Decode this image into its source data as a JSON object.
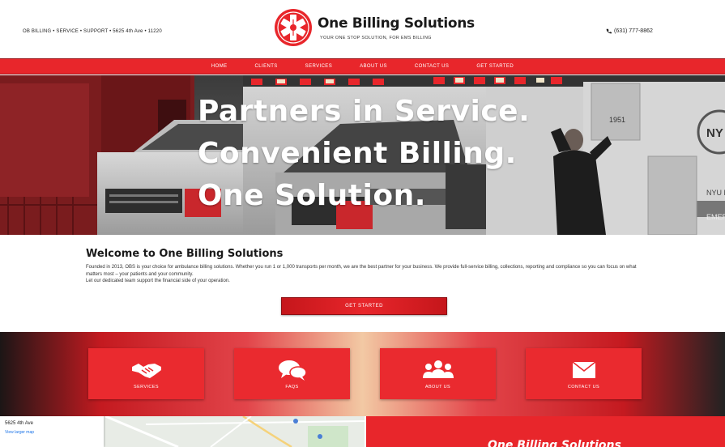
{
  "header": {
    "contact_left": "OB BILLING • SERVICE • SUPPORT • 5625 4th Ave • 11220",
    "brand_name": "One Billing Solutions",
    "tagline": "YOUR ONE STOP SOLUTION, FOR EMS BILLING",
    "phone": "(631) 777-8862",
    "phone_icon": "phone-icon"
  },
  "nav": {
    "items": [
      "HOME",
      "CLIENTS",
      "SERVICES",
      "ABOUT US",
      "CONTACT US",
      "GET STARTED"
    ]
  },
  "hero": {
    "lines": [
      "Partners in Service.",
      "Convenient Billing.",
      "One Solution."
    ]
  },
  "welcome": {
    "title": "Welcome to One Billing Solutions",
    "body": "Founded in 2013, OBS is your choice for ambulance billing solutions. Whether you run 1 or 1,000 transports per month, we are the best partner for your business. We provide full-service billing, collections, reporting and compliance so you can focus on what matters most – your patients and your community.",
    "body2": "Let our dedicated team support the financial side of your operation.",
    "cta_label": "GET STARTED"
  },
  "features": [
    {
      "label": "SERVICES",
      "icon": "handshake-icon"
    },
    {
      "label": "FAQS",
      "icon": "chat-bubbles-icon"
    },
    {
      "label": "ABOUT US",
      "icon": "team-icon"
    },
    {
      "label": "CONTACT US",
      "icon": "envelope-icon"
    }
  ],
  "bottom": {
    "map_title": "5625 4th Ave",
    "map_link": "View larger map",
    "panel_title": "One Billing Solutions"
  },
  "colors": {
    "brand_red": "#e8262b",
    "dark_red": "#9a1418"
  }
}
